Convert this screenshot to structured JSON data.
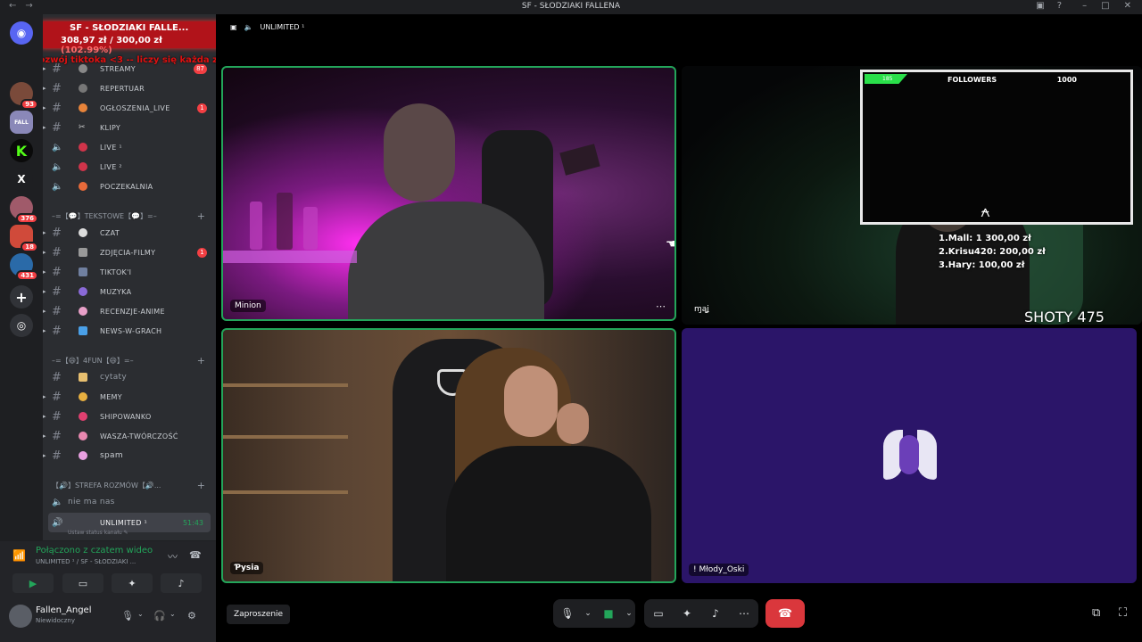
{
  "window": {
    "title": "SF - SŁODZIAKI FALLENA"
  },
  "server": {
    "name": "SF - SŁODZIAKI FALLE...",
    "donation_amount": "308,97 zł",
    "donation_goal": "/ 300,00 zł",
    "donation_percent": "(102.99%)",
    "donation_message": "Na rozwój tiktoka <3 -- liczy się każda zł <3"
  },
  "guilds": [
    {
      "name": "Discord",
      "badge": ""
    },
    {
      "name": "DM avatar",
      "badge": "93"
    },
    {
      "name": "Fallen",
      "badge": ""
    },
    {
      "name": "K",
      "badge": ""
    },
    {
      "name": "X",
      "badge": ""
    },
    {
      "name": "Server 5",
      "badge": "376"
    },
    {
      "name": "Server 6",
      "badge": "18"
    },
    {
      "name": "Server 7",
      "badge": "431"
    },
    {
      "name": "Add server",
      "badge": ""
    },
    {
      "name": "Discover",
      "badge": ""
    }
  ],
  "channels": {
    "top": [
      {
        "label": "STREAMY",
        "badge": "87"
      },
      {
        "label": "REPERTUAR",
        "badge": ""
      },
      {
        "label": "OGŁOSZENIA_LIVE",
        "badge": "1"
      },
      {
        "label": "KLIPY",
        "badge": ""
      },
      {
        "label": "LIVE ¹",
        "badge": ""
      },
      {
        "label": "LIVE ²",
        "badge": ""
      },
      {
        "label": "POCZEKALNIA",
        "badge": ""
      }
    ],
    "cat_text": "–=【💬】TEKSTOWE【💬】=–",
    "text": [
      {
        "label": "CZAT",
        "badge": ""
      },
      {
        "label": "ZDJĘCIA-FILMY",
        "badge": "1"
      },
      {
        "label": "TIKTOK'I",
        "badge": ""
      },
      {
        "label": "MUZYKA",
        "badge": ""
      },
      {
        "label": "RECENZJE-ANIME",
        "badge": ""
      },
      {
        "label": "NEWS-W-GRACH",
        "badge": ""
      }
    ],
    "cat_fun": "–=【😄】4FUN【😄】=–",
    "fun": [
      {
        "label": "cytaty",
        "badge": ""
      },
      {
        "label": "MEMY",
        "badge": ""
      },
      {
        "label": "SHIPOWANKO",
        "badge": ""
      },
      {
        "label": "WASZA-TWÓRCZOŚĆ",
        "badge": ""
      },
      {
        "label": "spam",
        "badge": ""
      }
    ],
    "cat_voice": "【🔊】STREFA ROZMÓW【🔊...",
    "voice_user": "nie ma nas",
    "active": {
      "label": "UNLIMITED ¹",
      "time": "51:43",
      "status": "Ustaw status kanału ✎"
    }
  },
  "voice": {
    "connected": "Połączono z czatem wideo",
    "channel": "UNLIMITED ¹ / SF - SŁODZIAKI ..."
  },
  "user": {
    "name": "Fallen_Angel",
    "status": "Niewidoczny"
  },
  "stage": {
    "header": "UNLIMITED ¹",
    "tiles": [
      {
        "name": "Minion"
      },
      {
        "name": "ɱąʝ"
      },
      {
        "name": "Ƥysia"
      },
      {
        "name": "! Młody_Oski"
      }
    ],
    "overlay": {
      "bar_value": "185",
      "followers_label": "FOLLOWERS",
      "followers_goal": "1000",
      "top_donors": [
        "1.Mall: 1 300,00 zł",
        "2.Krisu420: 200,00 zł",
        "3.Hary: 100,00 zł"
      ],
      "shoty": "SHOTY 475"
    },
    "invite": "Zaproszenie"
  },
  "colors": {
    "accent_green": "#23a55a",
    "leave_red": "#da373c",
    "badge_red": "#f23f43",
    "tile_purple": "#2b1569"
  },
  "icons": [
    "discord-icon",
    "hash-icon",
    "speaker-icon",
    "mic-icon",
    "camera-icon",
    "screen-share-icon",
    "activity-icon",
    "soundboard-icon",
    "more-icon",
    "hangup-icon",
    "popout-icon",
    "fullscreen-icon",
    "gear-icon",
    "headphones-icon"
  ]
}
